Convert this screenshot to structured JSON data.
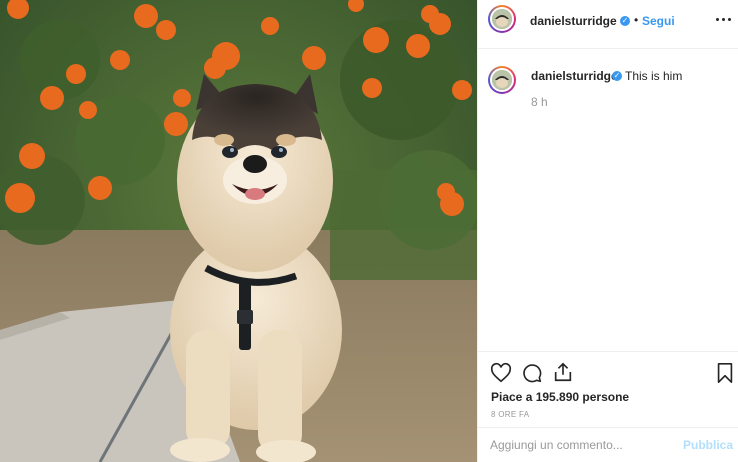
{
  "post": {
    "image_description_icon": "pomeranian-photo",
    "accent_color": "#3897f0",
    "header": {
      "username": "danielsturridge",
      "verified_icon": "verified-badge-icon",
      "separator": "•",
      "follow_label": "Segui",
      "more_icon": "more-options-icon"
    },
    "caption": {
      "username": "danielsturridge",
      "text": "This is him",
      "time": "8 h"
    },
    "actions": {
      "like_icon": "heart-icon",
      "comment_icon": "comment-icon",
      "share_icon": "share-icon",
      "save_icon": "bookmark-icon",
      "likes_text": "Piace a 195.890 persone",
      "timestamp": "8 ORE FA"
    },
    "comment_box": {
      "placeholder": "Aggiungi un commento...",
      "publish_label": "Pubblica"
    }
  }
}
